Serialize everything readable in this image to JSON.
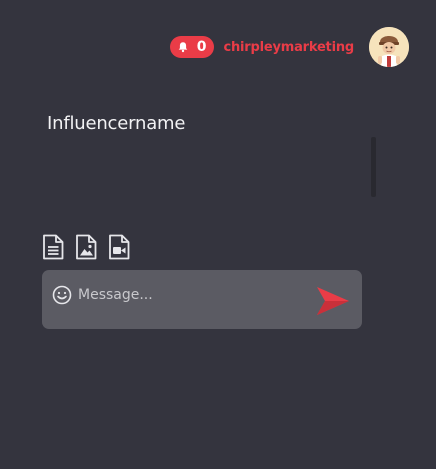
{
  "header": {
    "notification_count": "0",
    "username": "chirpleymarketing",
    "bell_icon": "bell-icon",
    "avatar": "user-avatar"
  },
  "conversation": {
    "recipient_name": "Influencername"
  },
  "attachments": [
    {
      "icon": "document-icon"
    },
    {
      "icon": "image-file-icon"
    },
    {
      "icon": "video-file-icon"
    }
  ],
  "composer": {
    "placeholder": "Message...",
    "value": "",
    "emoji_icon": "emoji-icon",
    "send_icon": "send-icon"
  },
  "colors": {
    "background": "#34343e",
    "accent": "#ea3c47",
    "composer_bg": "#5b5b63",
    "text": "#f2f2f4"
  }
}
